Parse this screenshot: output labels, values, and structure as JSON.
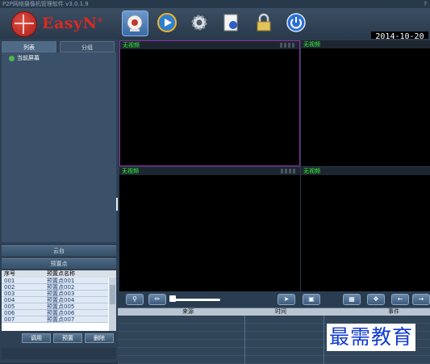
{
  "app": {
    "title": "P2P网络摄像机管理软件 v3.0.1.9",
    "help": "?"
  },
  "logo": {
    "brand": "EasyN",
    "reg": "®"
  },
  "toolbar": {
    "date": "2014-10-20"
  },
  "left": {
    "tabs": [
      "列表",
      "分组"
    ],
    "tree_item": "当前屏幕",
    "ptz_label": "云台",
    "preset_label": "预置点",
    "preset_headers": {
      "no": "序号",
      "name": "预置点名称"
    },
    "presets": [
      {
        "no": "001",
        "name": "预置点001"
      },
      {
        "no": "002",
        "name": "预置点002"
      },
      {
        "no": "003",
        "name": "预置点003"
      },
      {
        "no": "004",
        "name": "预置点004"
      },
      {
        "no": "005",
        "name": "预置点005"
      },
      {
        "no": "006",
        "name": "预置点006"
      },
      {
        "no": "007",
        "name": "预置点007"
      }
    ],
    "buttons": [
      "调用",
      "预置",
      "删除"
    ]
  },
  "video": {
    "cell_labels": [
      "无视频",
      "无视频",
      "无视频",
      "无视频"
    ]
  },
  "events": {
    "headers": {
      "source": "来源",
      "time": "时间",
      "event": "事件"
    }
  },
  "watermark": "最需教育",
  "colors": {
    "active_border": "#8d2fa4",
    "no_video_text": "#32ff32",
    "brand_red": "#d82b22"
  }
}
